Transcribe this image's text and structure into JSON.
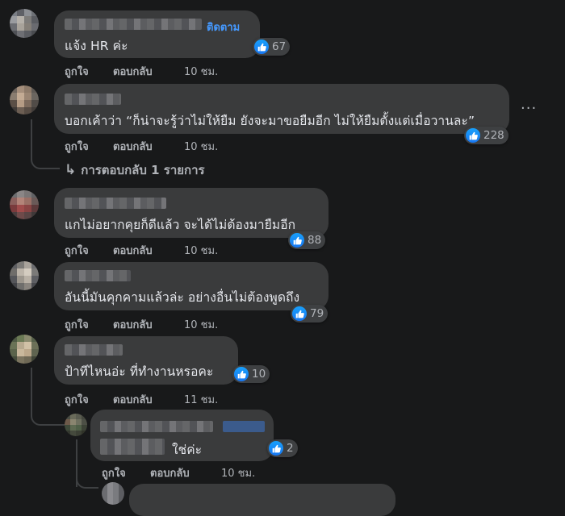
{
  "comments": [
    {
      "text": "แจ้ง HR ค่ะ",
      "follow": "ติดตาม",
      "likes": "67",
      "like_label": "ถูกใจ",
      "reply_label": "ตอบกลับ",
      "time": "10 ชม."
    },
    {
      "text": "บอกเค้าว่า “ก็น่าจะรู้ว่าไม่ให้ยืม ยังจะมาขอยืมอีก ไม่ให้ยืมตั้งแต่เมื่อวานละ”",
      "likes": "228",
      "like_label": "ถูกใจ",
      "reply_label": "ตอบกลับ",
      "time": "10 ชม.",
      "replies": "การตอบกลับ 1 รายการ"
    },
    {
      "text": "แกไม่อยากคุยก็ดีแล้ว จะได้ไม่ต้องมายืมอีก",
      "likes": "88",
      "like_label": "ถูกใจ",
      "reply_label": "ตอบกลับ",
      "time": "10 ชม."
    },
    {
      "text": "อันนี้มันคุกคามแล้วล่ะ อย่างอื่นไม่ต้องพูดถึง",
      "likes": "79",
      "like_label": "ถูกใจ",
      "reply_label": "ตอบกลับ",
      "time": "10 ชม."
    },
    {
      "text": "ป้าทีไหนอ่ะ ที่ทำงานหรอคะ",
      "likes": "10",
      "like_label": "ถูกใจ",
      "reply_label": "ตอบกลับ",
      "time": "11 ชม."
    },
    {
      "text": "ใช่ค่ะ",
      "likes": "2",
      "like_label": "ถูกใจ",
      "reply_label": "ตอบกลับ",
      "time": "10 ชม."
    }
  ],
  "icons": {
    "like": "thumbs-up-icon",
    "more": "more-options-icon",
    "reply_arrow": "reply-arrow-icon"
  },
  "colors": {
    "background": "#18191a",
    "bubble": "#3a3b3c",
    "accent": "#4599ff",
    "like": "#1877f2"
  }
}
